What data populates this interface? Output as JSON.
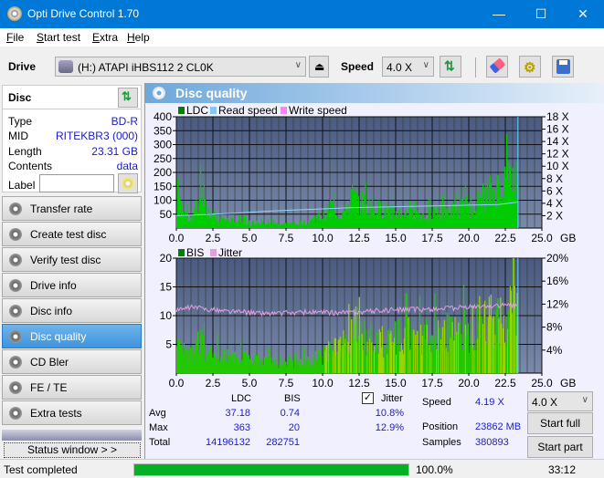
{
  "window": {
    "title": "Opti Drive Control 1.70",
    "icon": "disc-app-icon",
    "controls": [
      "minimize",
      "maximize",
      "close"
    ]
  },
  "menu": [
    {
      "label": "File",
      "accel": "F"
    },
    {
      "label": "Start test",
      "accel": "S"
    },
    {
      "label": "Extra",
      "accel": "E"
    },
    {
      "label": "Help",
      "accel": "H"
    }
  ],
  "toolbar": {
    "drive_label": "Drive",
    "drive_value": "(H:)  ATAPI iHBS112  2 CL0K",
    "speed_label": "Speed",
    "speed_value": "4.0 X",
    "icons": [
      "eject-icon",
      "refresh-icon",
      "erase-icon",
      "settings-icon",
      "save-icon"
    ]
  },
  "disc": {
    "header": "Disc",
    "rows": [
      {
        "k": "Type",
        "v": "BD-R"
      },
      {
        "k": "MID",
        "v": "RITEKBR3 (000)"
      },
      {
        "k": "Length",
        "v": "23.31 GB"
      },
      {
        "k": "Contents",
        "v": "data"
      }
    ],
    "label_key": "Label",
    "label_value": ""
  },
  "nav": [
    {
      "label": "Transfer rate",
      "active": false
    },
    {
      "label": "Create test disc",
      "active": false
    },
    {
      "label": "Verify test disc",
      "active": false
    },
    {
      "label": "Drive info",
      "active": false
    },
    {
      "label": "Disc info",
      "active": false
    },
    {
      "label": "Disc quality",
      "active": true
    },
    {
      "label": "CD Bler",
      "active": false
    },
    {
      "label": "FE / TE",
      "active": false
    },
    {
      "label": "Extra tests",
      "active": false
    }
  ],
  "status_window_label": "Status window > >",
  "panel_title": "Disc quality",
  "chart_data": [
    {
      "type": "area",
      "title": "LDC",
      "legend": [
        {
          "name": "LDC",
          "color": "#008000"
        },
        {
          "name": "Read speed",
          "color": "#80c8ff"
        },
        {
          "name": "Write speed",
          "color": "#ff80ff"
        }
      ],
      "xlabel": "GB",
      "x_ticks": [
        "0.0",
        "2.5",
        "5.0",
        "7.5",
        "10.0",
        "12.5",
        "15.0",
        "17.5",
        "20.0",
        "22.5",
        "25.0"
      ],
      "xlim": [
        0,
        25
      ],
      "y_left_ticks": [
        "50",
        "100",
        "150",
        "200",
        "250",
        "300",
        "350",
        "400"
      ],
      "ylim_left": [
        0,
        400
      ],
      "y_right_ticks": [
        "2 X",
        "4 X",
        "6 X",
        "8 X",
        "10 X",
        "12 X",
        "14 X",
        "16 X",
        "18 X"
      ],
      "ylim_right": [
        0,
        18
      ],
      "ldc_series": {
        "x": [
          0,
          0.5,
          1,
          1.5,
          1.8,
          2,
          2.5,
          3,
          4,
          5,
          6,
          7,
          8,
          9,
          9.5,
          10,
          10.5,
          11,
          11.5,
          12,
          12.5,
          13,
          14,
          15,
          16,
          17,
          18,
          19,
          20,
          20.5,
          21,
          21.5,
          22,
          22.5,
          23,
          23.3
        ],
        "y": [
          120,
          60,
          45,
          110,
          190,
          80,
          55,
          40,
          30,
          25,
          20,
          18,
          20,
          30,
          45,
          55,
          100,
          60,
          70,
          140,
          120,
          100,
          80,
          70,
          60,
          60,
          75,
          80,
          100,
          110,
          140,
          160,
          180,
          210,
          220,
          230
        ]
      },
      "read_speed": {
        "x": [
          0,
          2,
          4,
          6,
          8,
          10,
          12,
          14,
          16,
          18,
          20,
          22,
          23.3
        ],
        "y": [
          2.0,
          2.2,
          2.4,
          2.7,
          2.9,
          3.1,
          3.3,
          3.4,
          3.5,
          3.6,
          3.7,
          3.8,
          4.19
        ]
      }
    },
    {
      "type": "area",
      "title": "BIS",
      "legend": [
        {
          "name": "BIS",
          "color": "#008000"
        },
        {
          "name": "Jitter",
          "color": "#e0a0e0"
        }
      ],
      "xlabel": "GB",
      "x_ticks": [
        "0.0",
        "2.5",
        "5.0",
        "7.5",
        "10.0",
        "12.5",
        "15.0",
        "17.5",
        "20.0",
        "22.5",
        "25.0"
      ],
      "xlim": [
        0,
        25
      ],
      "y_left_ticks": [
        "5",
        "10",
        "15",
        "20"
      ],
      "ylim_left": [
        0,
        20
      ],
      "y_right_ticks": [
        "4%",
        "8%",
        "12%",
        "16%",
        "20%"
      ],
      "ylim_right": [
        0,
        20
      ],
      "bis_series": {
        "x": [
          0,
          1,
          1.5,
          2,
          3,
          4,
          5,
          6,
          7,
          8,
          9,
          10,
          11,
          12,
          12.5,
          13,
          14,
          15,
          16,
          17,
          18,
          19,
          20,
          21,
          22,
          22.5,
          23,
          23.3
        ],
        "y": [
          5,
          4,
          7,
          5,
          4,
          4,
          3,
          3,
          2,
          2,
          3,
          4,
          6,
          8,
          12,
          8,
          7,
          8,
          9,
          8,
          9,
          9,
          10,
          12,
          11,
          14,
          13,
          12
        ]
      },
      "jitter_series": {
        "x": [
          0,
          1,
          2,
          3,
          5,
          7,
          9,
          11,
          13,
          15,
          17,
          19,
          21,
          23,
          23.3
        ],
        "y": [
          10.8,
          11.5,
          11.2,
          10.9,
          10.5,
          10.4,
          10.6,
          10.5,
          10.7,
          11.0,
          11.1,
          11.3,
          11.6,
          11.8,
          11.7
        ]
      }
    }
  ],
  "stats": {
    "headers": [
      "",
      "LDC",
      "BIS"
    ],
    "rows": [
      {
        "k": "Avg",
        "ldc": "37.18",
        "bis": "0.74",
        "jitter": "10.8%"
      },
      {
        "k": "Max",
        "ldc": "363",
        "bis": "20",
        "jitter": "12.9%"
      },
      {
        "k": "Total",
        "ldc": "14196132",
        "bis": "282751",
        "jitter": ""
      }
    ],
    "jitter_label": "Jitter",
    "jitter_checked": true,
    "speed_label": "Speed",
    "speed_value": "4.19 X",
    "position_label": "Position",
    "position_value": "23862 MB",
    "samples_label": "Samples",
    "samples_value": "380893",
    "speed_select": "4.0 X",
    "start_full": "Start full",
    "start_part": "Start part"
  },
  "statusbar": {
    "text": "Test completed",
    "progress": 100.0,
    "progress_text": "100.0%",
    "time": "33:12"
  }
}
